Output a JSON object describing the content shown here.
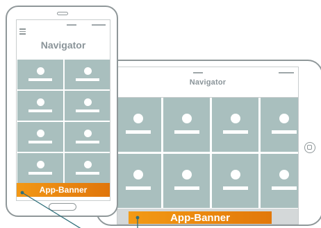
{
  "tablet": {
    "title": "Navigator",
    "banner_label": "App-Banner",
    "tile_count": 8
  },
  "phone": {
    "title": "Navigator",
    "banner_label": "App-Banner",
    "tile_count": 8
  },
  "icons": {
    "menu": "hamburger-menu-icon",
    "user": "user-placeholder-icon",
    "home": "home-button-icon"
  },
  "colors": {
    "tile": "#a9bfbe",
    "banner_start": "#f39a14",
    "banner_end": "#e2780a",
    "title_text": "#8a9499",
    "device_frame": "#8f9799",
    "pointer_line": "#2f6f7a"
  }
}
